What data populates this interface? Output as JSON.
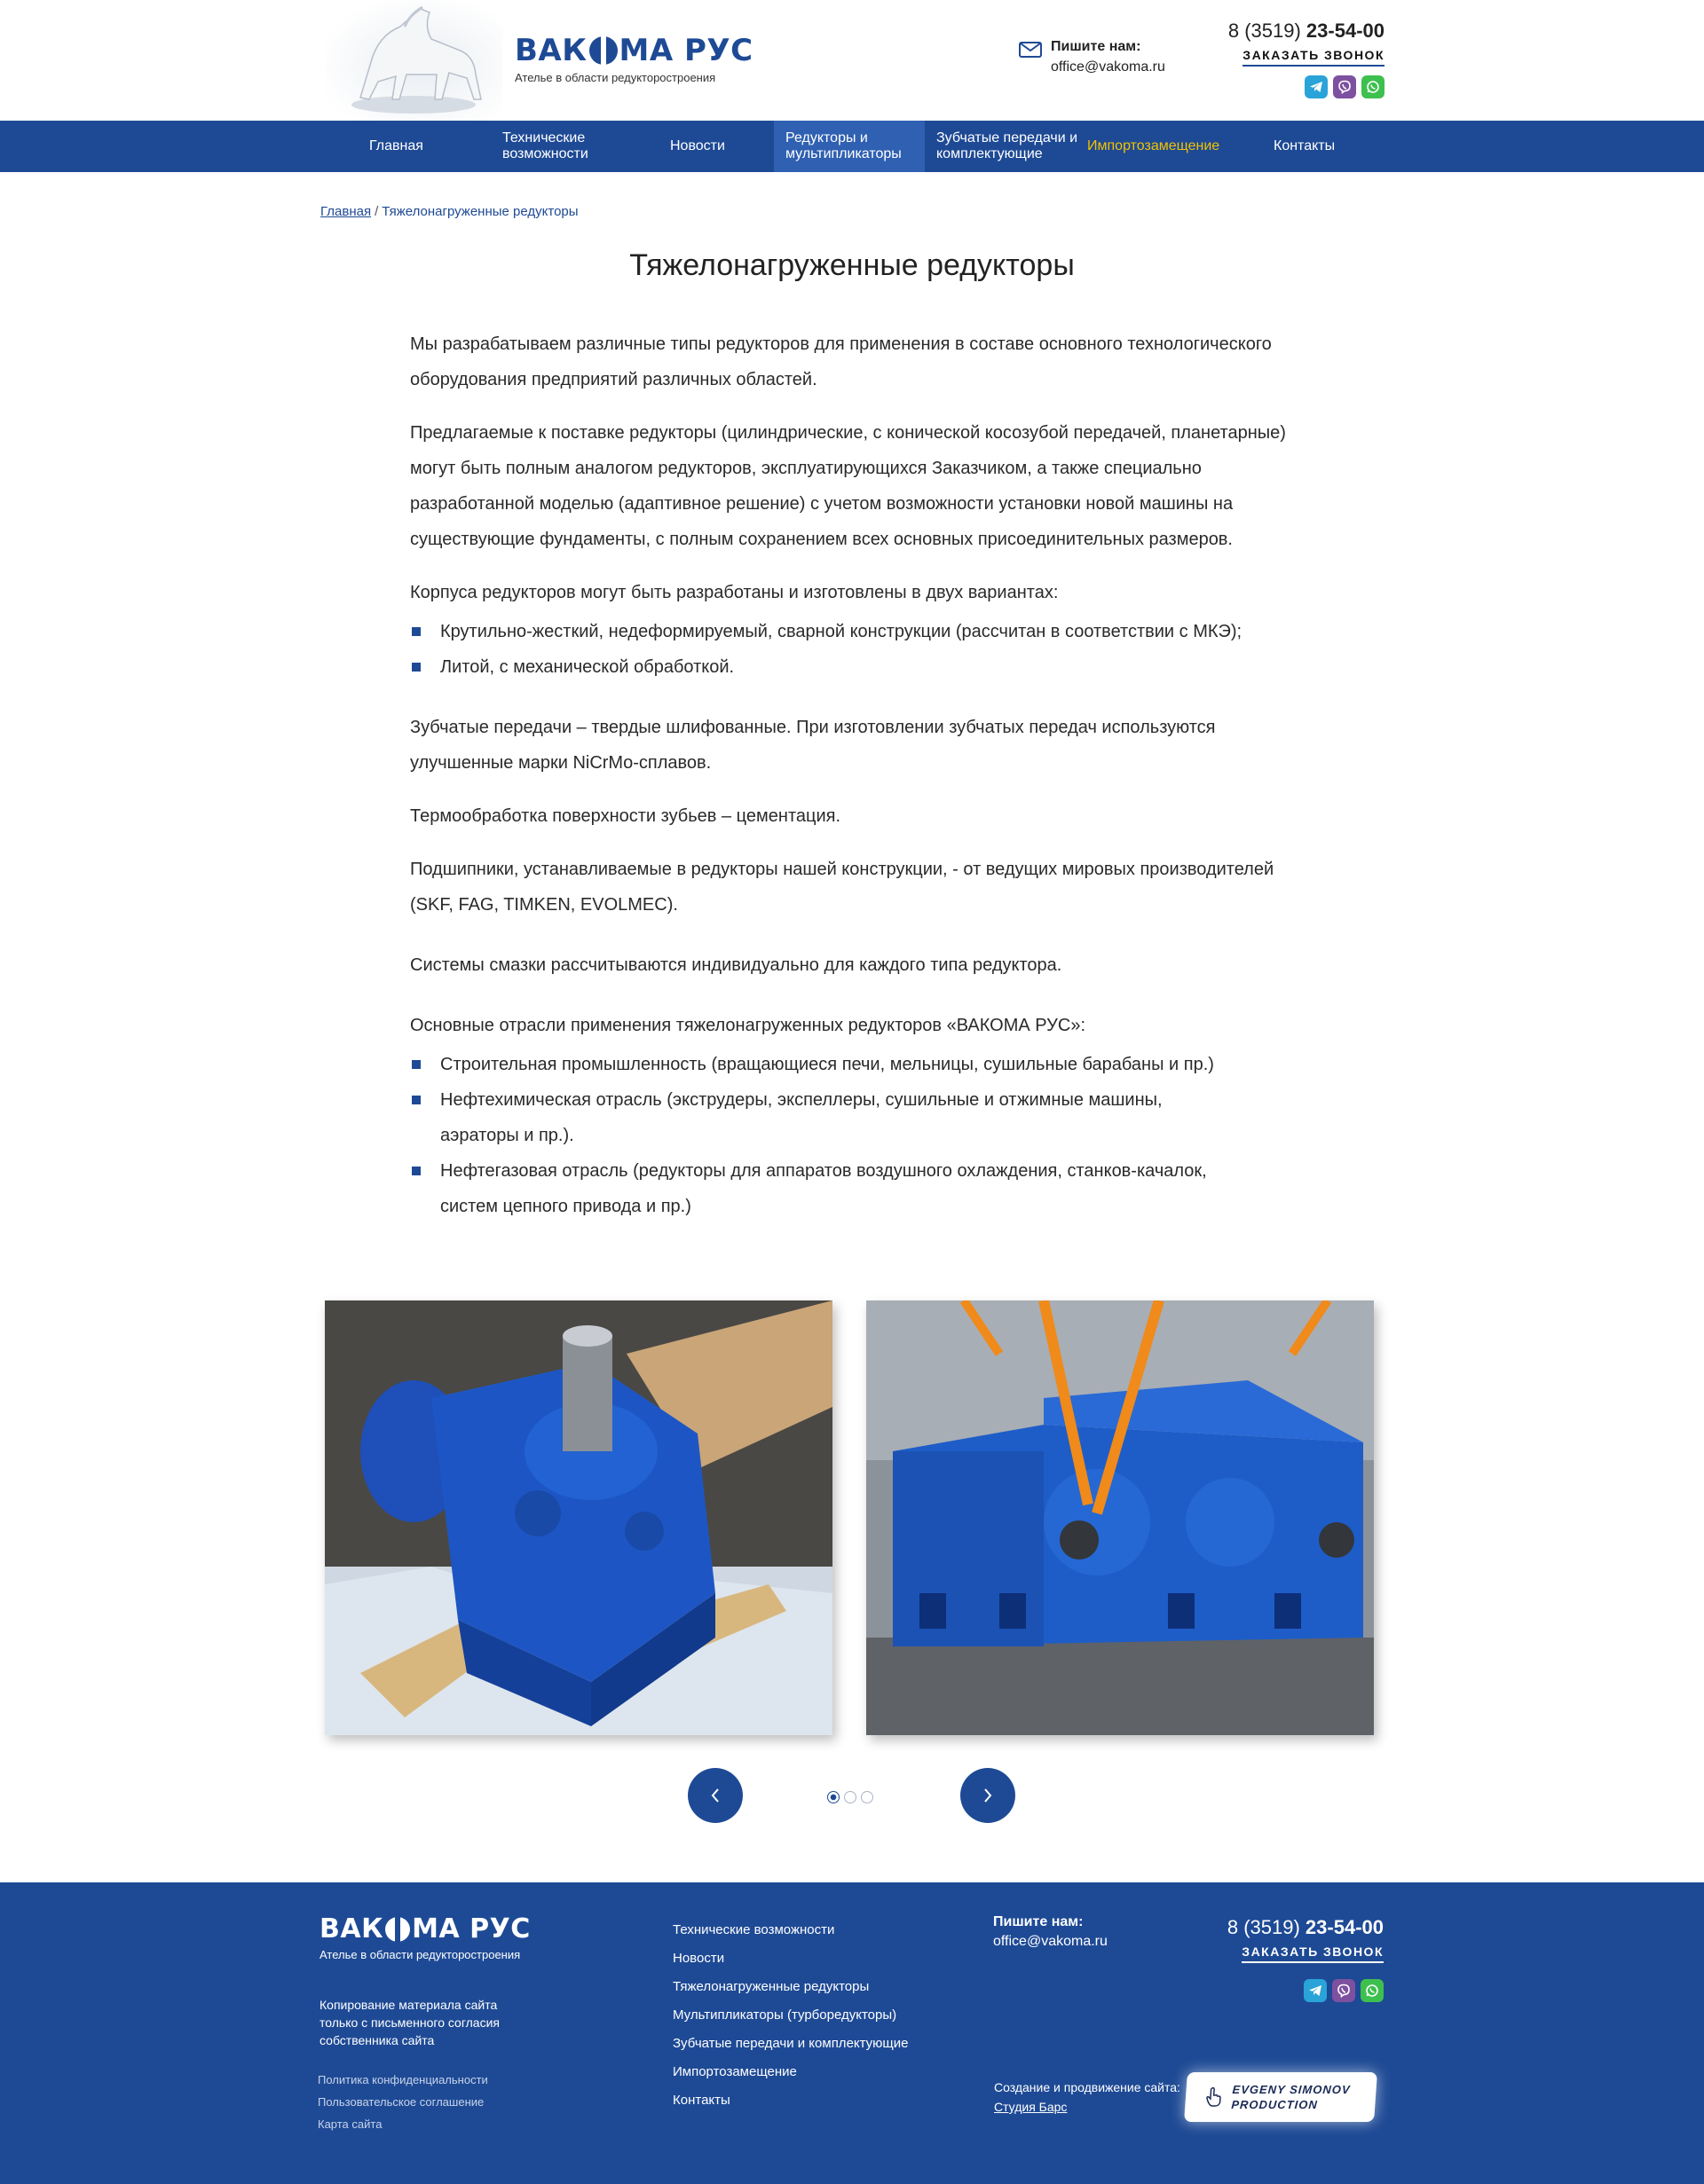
{
  "header": {
    "logo_text": "ВАКОМА РУС",
    "logo_subtitle": "Ателье в области редукторостроения",
    "mail_label": "Пишите нам:",
    "mail_value": "office@vakoma.ru",
    "phone_prefix": "8 (3519)",
    "phone_number": "23-54-00",
    "callback_label": "ЗАКАЗАТЬ ЗВОНОК"
  },
  "nav": {
    "items": [
      {
        "label": "Главная"
      },
      {
        "label": "Технические возможности"
      },
      {
        "label": "Новости"
      },
      {
        "label": "Редукторы и мультипликаторы"
      },
      {
        "label": "Зубчатые передачи и комплектующие"
      },
      {
        "label": "Импортозамещение"
      },
      {
        "label": "Контакты"
      }
    ]
  },
  "breadcrumb": {
    "home": "Главная",
    "separator": "/",
    "current": "Тяжелонагруженные редукторы"
  },
  "page_title": "Тяжелонагруженные редукторы",
  "article": {
    "p1": "Мы разрабатываем различные типы редукторов для применения в составе основного технологического оборудования предприятий различных областей.",
    "p2": "Предлагаемые к поставке редукторы (цилиндрические, с конической косозубой передачей, планетарные) могут быть полным аналогом редукторов, эксплуатирующихся Заказчиком, а также специально разработанной моделью (адаптивное решение) с учетом возможности установки новой машины на существующие фундаменты, с полным сохранением всех основных присоединительных размеров.",
    "p3": "Корпуса редукторов могут быть разработаны и изготовлены в двух вариантах:",
    "list1": [
      "Крутильно-жесткий, недеформируемый, сварной конструкции (рассчитан в соответствии с МКЭ);",
      "Литой, с механической обработкой."
    ],
    "p4": "Зубчатые передачи – твердые шлифованные. При изготовлении зубчатых передач используются улучшенные марки NiCrMo-сплавов.",
    "p5": "Термообработка поверхности зубьев – цементация.",
    "p6": "Подшипники, устанавливаемые в редукторы нашей конструкции, - от ведущих мировых производителей (SKF, FAG, TIMKEN, EVOLMEC).",
    "p7": "Системы смазки рассчитываются индивидуально для каждого типа редуктора.",
    "p8": "Основные отрасли применения тяжелонагруженных редукторов «ВАКОМА РУС»:",
    "list2": [
      "Строительная промышленность (вращающиеся печи, мельницы, сушильные барабаны и пр.)",
      "Нефтехимическая отрасль (экструдеры, экспеллеры, сушильные и отжимные машины, аэраторы и пр.).",
      "Нефтегазовая отрасль (редукторы для аппаратов воздушного охлаждения, станков-качалок, систем цепного привода и пр.)"
    ]
  },
  "gallery": {
    "slide_count": 3,
    "active_slide": 1
  },
  "footer": {
    "logo_text": "ВАКОМА РУС",
    "logo_subtitle": "Ателье в области редукторостроения",
    "copyright": "Копирование материала сайта только с письменного согласия собственника сайта",
    "legal": [
      "Политика конфиденциальности",
      "Пользовательское соглашение",
      "Карта сайта"
    ],
    "menu": [
      "Технические возможности",
      "Новости",
      "Тяжелонагруженные редукторы",
      "Мультипликаторы (турборедукторы)",
      "Зубчатые передачи и комплектующие",
      "Импортозамещение",
      "Контакты"
    ],
    "mail_label": "Пишите нам:",
    "mail_value": "office@vakoma.ru",
    "phone_prefix": "8 (3519)",
    "phone_number": "23-54-00",
    "callback_label": "ЗАКАЗАТЬ ЗВОНОК",
    "studio_text": "Создание и продвижение сайта:",
    "studio_link": "Студия Барс",
    "badge_line1": "EVGENY SIMONOV",
    "badge_line2": "PRODUCTION"
  },
  "colors": {
    "brand_blue": "#1e4a95",
    "nav_active": "#2f60b2",
    "nav_accent": "#f2c200"
  },
  "icons": [
    "mail-icon",
    "telegram-icon",
    "viber-icon",
    "whatsapp-icon",
    "arrow-left-icon",
    "arrow-right-icon",
    "hand-pointer-icon"
  ]
}
